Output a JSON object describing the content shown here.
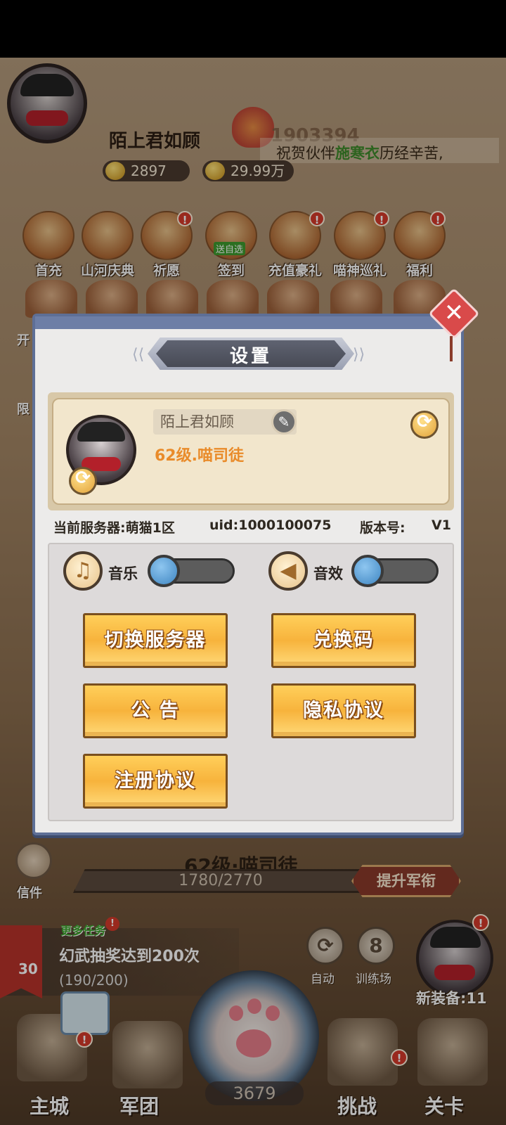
{
  "hud": {
    "player_name": "陌上君如顾",
    "power": "1903394",
    "gold": "2897",
    "coins": "29.99万",
    "marquee_prefix": "祝贺伙伴",
    "marquee_name": "施寒衣",
    "marquee_suffix": "历经辛苦,"
  },
  "features": [
    {
      "label": "首充",
      "badge": ""
    },
    {
      "label": "山河庆典",
      "badge": ""
    },
    {
      "label": "祈愿",
      "badge": "!"
    },
    {
      "label": "签到",
      "badge": "",
      "tag": "送自选"
    },
    {
      "label": "充值豪礼",
      "badge": "!"
    },
    {
      "label": "喵神巡礼",
      "badge": "!"
    },
    {
      "label": "福利",
      "badge": "!"
    }
  ],
  "side_labels": {
    "first": "开",
    "second": "限"
  },
  "settings": {
    "title": "设置",
    "profile": {
      "name": "陌上君如顾",
      "level_title": "62级.喵司徒"
    },
    "server_label": "当前服务器:萌猫1区",
    "uid_label": "uid:1000100075",
    "version_label": "版本号:",
    "version_value": "V1",
    "music_label": "音乐",
    "sfx_label": "音效",
    "buttons": {
      "switch_server": "切换服务器",
      "redeem_code": "兑换码",
      "announcement": "公 告",
      "privacy": "隐私协议",
      "register": "注册协议"
    },
    "close_symbol": "✕"
  },
  "rank": {
    "title": "62级·喵司徒",
    "exp": "1780/2770",
    "exp_fraction": 0.643,
    "upgrade_label": "提升军衔"
  },
  "mail_label": "信件",
  "quest": {
    "more_label": "更多任务",
    "level": "30",
    "title": "幻武抽奖达到200次",
    "progress": "(190/200)"
  },
  "auto": {
    "label": "自动"
  },
  "training": {
    "label": "训练场",
    "count": "8"
  },
  "equip_label": "新装备:11",
  "coin_total": "3679",
  "nav": {
    "city": "主城",
    "legion": "军团",
    "challenge": "挑战",
    "stage": "关卡"
  },
  "icons": [
    "gold-ingot-icon",
    "coin-icon",
    "music-note-icon",
    "speaker-icon",
    "refresh-icon",
    "pencil-icon",
    "close-icon",
    "mail-icon",
    "paw-icon"
  ],
  "colors": {
    "panel_frame": "#5e6f96",
    "button_orange": "#f7b33c",
    "level_orange": "#e98b2a",
    "alert_red": "#d43a2a",
    "toggle_knob": "#3f86c2"
  }
}
